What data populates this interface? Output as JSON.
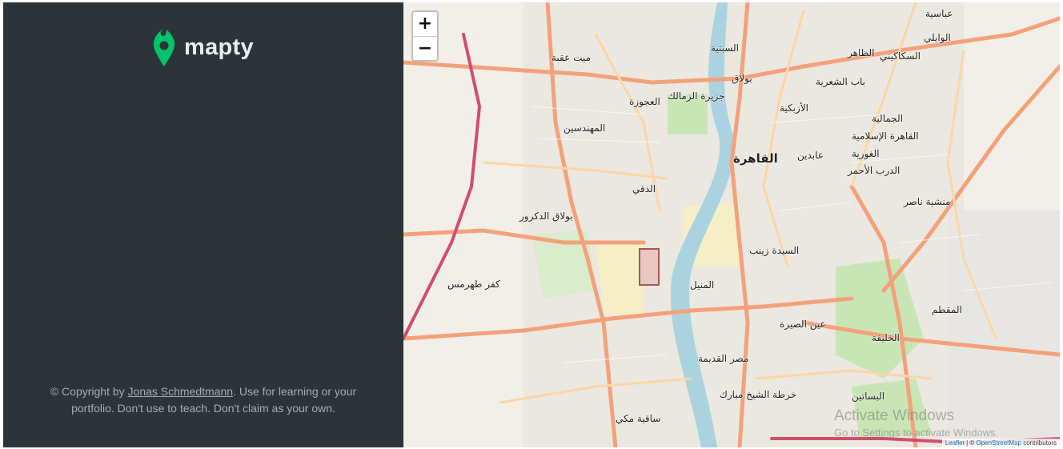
{
  "sidebar": {
    "logo_text": "mapty",
    "copyright_prefix": "© Copyright by ",
    "author_link": "Jonas Schmedtmann",
    "copyright_suffix": ". Use for learning or your portfolio. Don't use to teach. Don't claim as your own."
  },
  "map": {
    "zoom_in": "+",
    "zoom_out": "−",
    "attribution_leaflet": "Leaflet",
    "attribution_sep": " | © ",
    "attribution_osm": "OpenStreetMap",
    "attribution_suffix": " contributors",
    "places": {
      "cairo": "القاهرة",
      "zamalek": "جزيرة الزمالك",
      "bulaq": "بولاق",
      "agouza": "العجوزة",
      "mohandessin": "المهندسين",
      "dokki": "الدقي",
      "bulaq_dakrour": "بولاق الدكرور",
      "kafr_tuhrmus": "كفر طهرمس",
      "sayeda_zeinab": "السيدة زينب",
      "manial": "المنيل",
      "old_cairo": "مصر القديمة",
      "ain_sira": "عين الصيرة",
      "khalifa": "الخليفة",
      "mokattam": "المقطم",
      "manshiyat_nasser": "منشية ناصر",
      "azbakeya": "الأزبكية",
      "bab_shaaria": "باب الشعرية",
      "abdeen": "عابدين",
      "islamic_cairo": "القاهرة الإسلامية",
      "gamaliya": "الجمالية",
      "sakakini": "السكاكيني",
      "zaher": "الظاهر",
      "waili": "الوايلي",
      "abbasiya": "عباسية",
      "mit_okba": "ميت عقبة",
      "darb_ahmar": "الدرب الأحمر",
      "ghouriya": "الغورية",
      "sabtiya": "السبتية",
      "sakiat_mekki": "ساقية مكي",
      "basateen": "البساتين",
      "khartat_sheikh": "خرطة الشيخ مبارك"
    },
    "watermark_title": "Activate Windows",
    "watermark_sub": "Go to Settings to activate Windows."
  },
  "colors": {
    "sidebar_bg": "#2d3439",
    "brand_green": "#00c46a",
    "river": "#aad3df",
    "major_road": "#f4a17a",
    "primary_road": "#fcd6a4",
    "park": "#c8e6b5"
  }
}
